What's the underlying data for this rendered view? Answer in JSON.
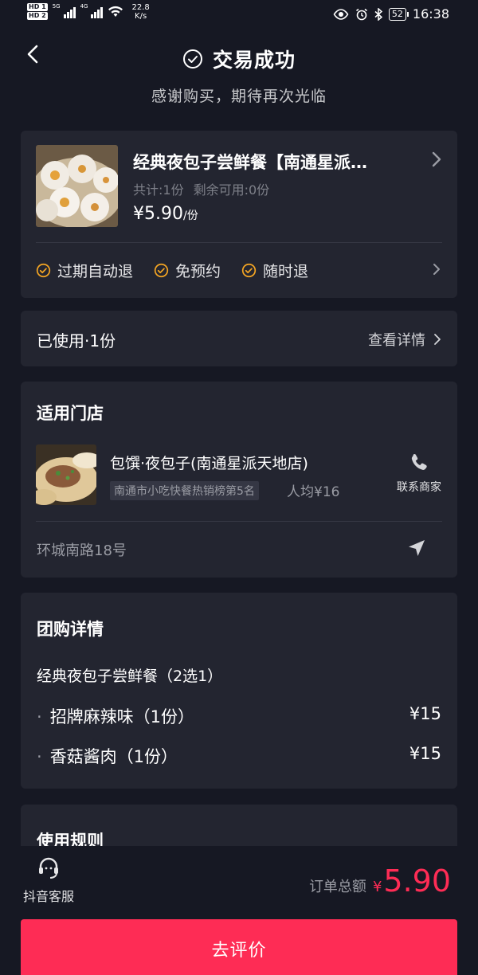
{
  "status_bar": {
    "hd1": "HD 1",
    "hd2": "HD 2",
    "net1": "5G",
    "net2": "4G",
    "speed_value": "22.8",
    "speed_unit": "K/s",
    "battery": "52",
    "time": "16:38"
  },
  "header": {
    "title": "交易成功",
    "subtitle": "感谢购买，期待再次光临"
  },
  "product": {
    "name": "经典夜包子尝鲜餐【南通星派…",
    "total": "共计:1份",
    "remaining": "剩余可用:0份",
    "price": "¥5.90",
    "price_unit": "/份",
    "tags": [
      "过期自动退",
      "免预约",
      "随时退"
    ]
  },
  "usage": {
    "label": "已使用·1份",
    "link": "查看详情"
  },
  "store": {
    "section_title": "适用门店",
    "name": "包馔·夜包子(南通星派天地店)",
    "rank": "南通市小吃快餐热销榜第5名",
    "avg": "人均¥16",
    "contact_label": "联系商家",
    "address": "环城南路18号"
  },
  "group_details": {
    "section_title": "团购详情",
    "package_name": "经典夜包子尝鲜餐（2选1）",
    "items": [
      {
        "bullet": "·",
        "name": "招牌麻辣味（1份）",
        "price": "¥15"
      },
      {
        "bullet": "·",
        "name": "香菇酱肉（1份）",
        "price": "¥15"
      }
    ]
  },
  "rules": {
    "section_title": "使用规则"
  },
  "footer": {
    "service_label": "抖音客服",
    "total_label": "订单总额",
    "total_currency": "¥",
    "total_amount": "5.90",
    "cta_label": "去评价"
  },
  "colors": {
    "background": "#161823",
    "card": "#232530",
    "accent": "#fe2c55",
    "tag_icon": "#f5a623"
  }
}
